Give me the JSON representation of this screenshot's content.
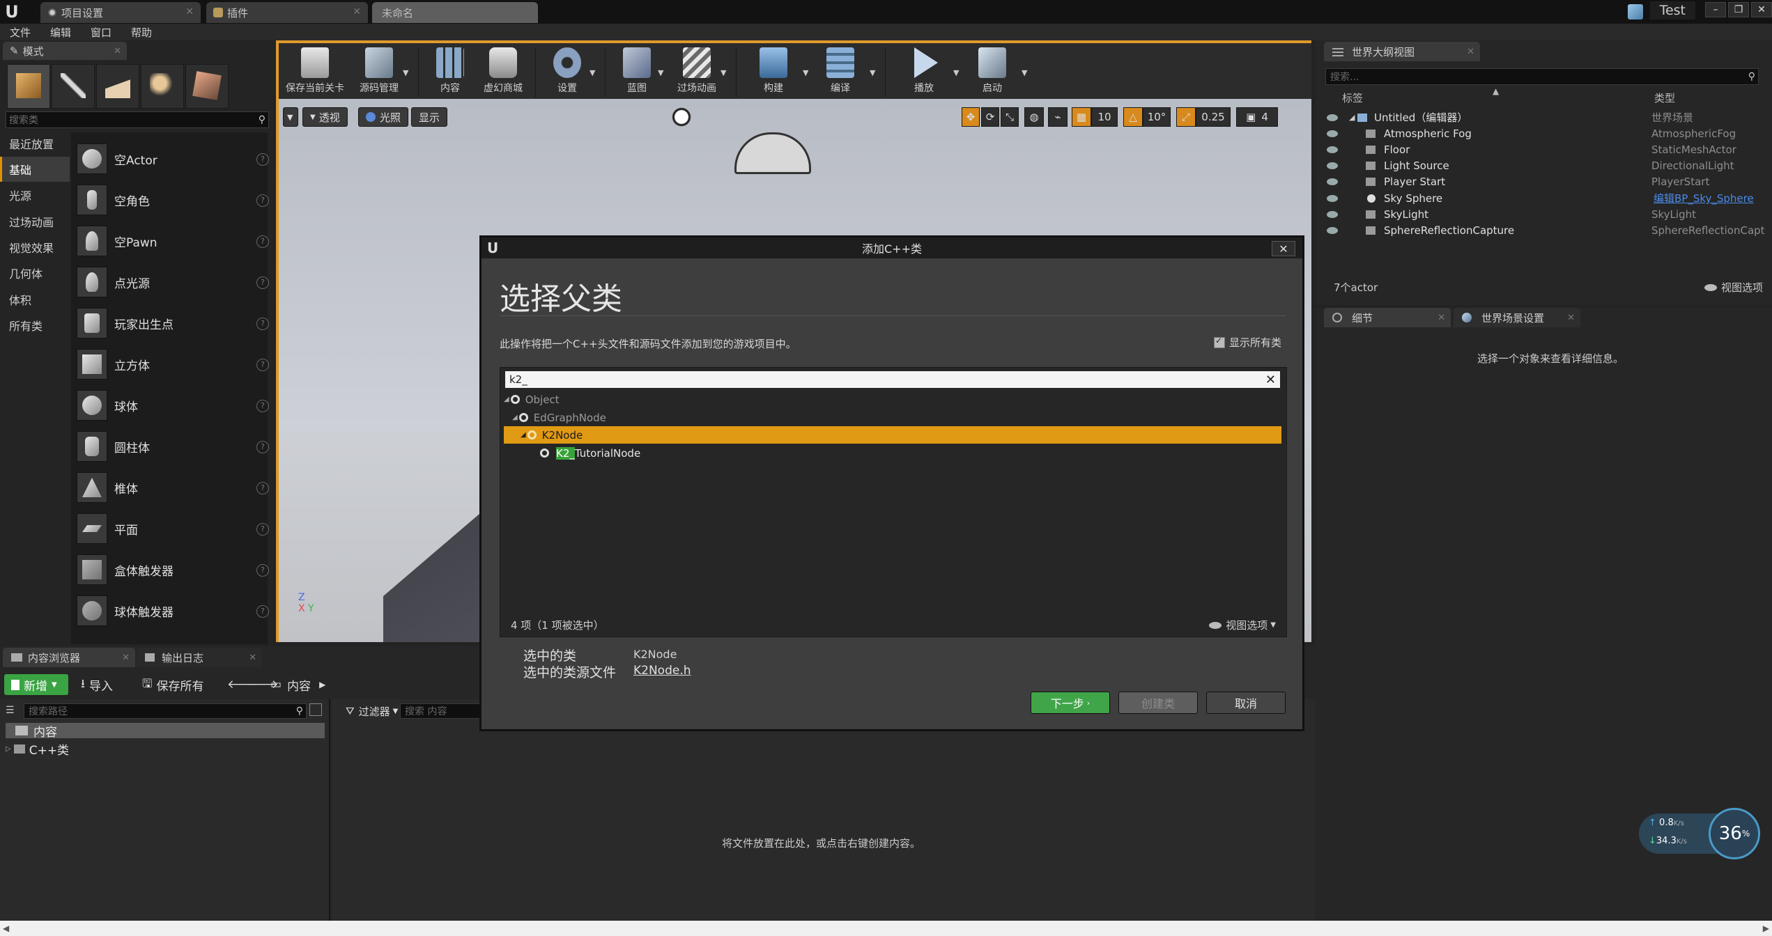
{
  "app": {
    "tabs": [
      {
        "label": "项目设置"
      },
      {
        "label": "插件"
      },
      {
        "label": "未命名"
      }
    ],
    "project_name": "Test",
    "menu": [
      "文件",
      "编辑",
      "窗口",
      "帮助"
    ]
  },
  "modes": {
    "tab_label": "模式",
    "search_placeholder": "搜索类",
    "categories": [
      "最近放置",
      "基础",
      "光源",
      "过场动画",
      "视觉效果",
      "几何体",
      "体积",
      "所有类"
    ],
    "items": [
      "空Actor",
      "空角色",
      "空Pawn",
      "点光源",
      "玩家出生点",
      "立方体",
      "球体",
      "圆柱体",
      "椎体",
      "平面",
      "盒体触发器",
      "球体触发器"
    ]
  },
  "toolbar": {
    "buttons": [
      "保存当前关卡",
      "源码管理",
      "内容",
      "虚幻商城",
      "设置",
      "蓝图",
      "过场动画",
      "构建",
      "编译",
      "播放",
      "启动"
    ]
  },
  "viewport": {
    "perspective_label": "透视",
    "lit_label": "光照",
    "show_label": "显示",
    "grid_snap": "10",
    "rot_snap": "10°",
    "scale_snap": "0.25",
    "cam_speed": "4"
  },
  "outliner": {
    "tab_label": "世界大纲视图",
    "search_placeholder": "搜索...",
    "col_label": "标签",
    "col_type": "类型",
    "rows": [
      {
        "label": "Untitled（编辑器）",
        "type": "世界场景"
      },
      {
        "label": "Atmospheric Fog",
        "type": "AtmosphericFog"
      },
      {
        "label": "Floor",
        "type": "StaticMeshActor"
      },
      {
        "label": "Light Source",
        "type": "DirectionalLight"
      },
      {
        "label": "Player Start",
        "type": "PlayerStart"
      },
      {
        "label": "Sky Sphere",
        "type": "编辑BP_Sky_Sphere"
      },
      {
        "label": "SkyLight",
        "type": "SkyLight"
      },
      {
        "label": "SphereReflectionCapture",
        "type": "SphereReflectionCapt"
      }
    ],
    "actor_count": "7个actor",
    "view_options": "视图选项"
  },
  "details": {
    "tab_details": "细节",
    "tab_world": "世界场景设置",
    "empty_text": "选择一个对象来查看详细信息。"
  },
  "content_browser": {
    "tab_label": "内容浏览器",
    "log_tab_label": "输出日志",
    "new_label": "新增",
    "import_label": "导入",
    "save_all_label": "保存所有",
    "path_label": "内容",
    "path_search_placeholder": "搜索路径",
    "filter_label": "过滤器",
    "content_search_placeholder": "搜索 内容",
    "tree": [
      "内容",
      "C++类"
    ],
    "empty_hint": "将文件放置在此处，或点击右键创建内容。"
  },
  "dialog": {
    "title": "添加C++类",
    "heading": "选择父类",
    "description": "此操作将把一个C++头文件和源码文件添加到您的游戏项目中。",
    "show_all_label": "显示所有类",
    "search_value": "k2_",
    "tree": [
      {
        "label": "Object",
        "level": 0
      },
      {
        "label": "EdGraphNode",
        "level": 1
      },
      {
        "label": "K2Node",
        "level": 2,
        "selected": true
      },
      {
        "label_highlight": "K2_",
        "label_rest": "TutorialNode",
        "level": 3
      }
    ],
    "item_count": "4 项（1 项被选中）",
    "view_options": "视图选项",
    "selected_class_label": "选中的类",
    "selected_class_value": "K2Node",
    "selected_file_label": "选中的类源文件",
    "selected_file_value": "K2Node.h",
    "next_label": "下一步",
    "create_label": "创建类",
    "cancel_label": "取消"
  },
  "network": {
    "up": "0.8",
    "down": "34.3",
    "unit": "K/s",
    "percent": "36",
    "percent_sign": "%"
  },
  "colors": {
    "accent": "#e09a2c",
    "selection": "#e09a13",
    "green": "#3aa343"
  }
}
